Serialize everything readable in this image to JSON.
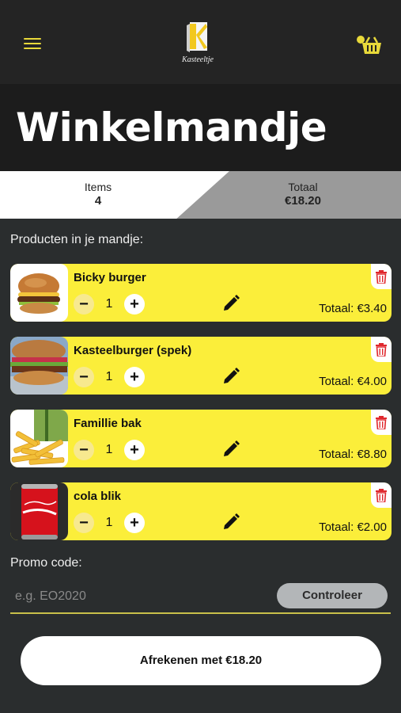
{
  "header": {
    "logo_text": "Kasteeltje",
    "menu_icon": "hamburger-menu-icon",
    "cart_icon": "shopping-basket-icon"
  },
  "page": {
    "title": "Winkelmandje"
  },
  "summary": {
    "items_label": "Items",
    "items_value": "4",
    "total_label": "Totaal",
    "total_value": "€18.20"
  },
  "cart": {
    "section_label": "Producten in je mandje:",
    "items": [
      {
        "name": "Bicky burger",
        "quantity": "1",
        "total": "Totaal: €3.40",
        "image": "burger-image"
      },
      {
        "name": "Kasteelburger (spek)",
        "quantity": "1",
        "total": "Totaal: €4.00",
        "image": "bacon-burger-image"
      },
      {
        "name": "Famillie bak",
        "quantity": "1",
        "total": "Totaal: €8.80",
        "image": "fries-image"
      },
      {
        "name": "cola blik",
        "quantity": "1",
        "total": "Totaal: €2.00",
        "image": "cola-can-image"
      }
    ],
    "minus_symbol": "−",
    "plus_symbol": "+"
  },
  "promo": {
    "label": "Promo code:",
    "placeholder": "e.g. EO2020",
    "value": "",
    "button_label": "Controleer"
  },
  "checkout": {
    "button_label": "Afrekenen met €18.20"
  },
  "colors": {
    "accent_yellow": "#fbee3a",
    "background": "#2a2d2e",
    "header": "#242424",
    "delete_red": "#e0282e"
  }
}
